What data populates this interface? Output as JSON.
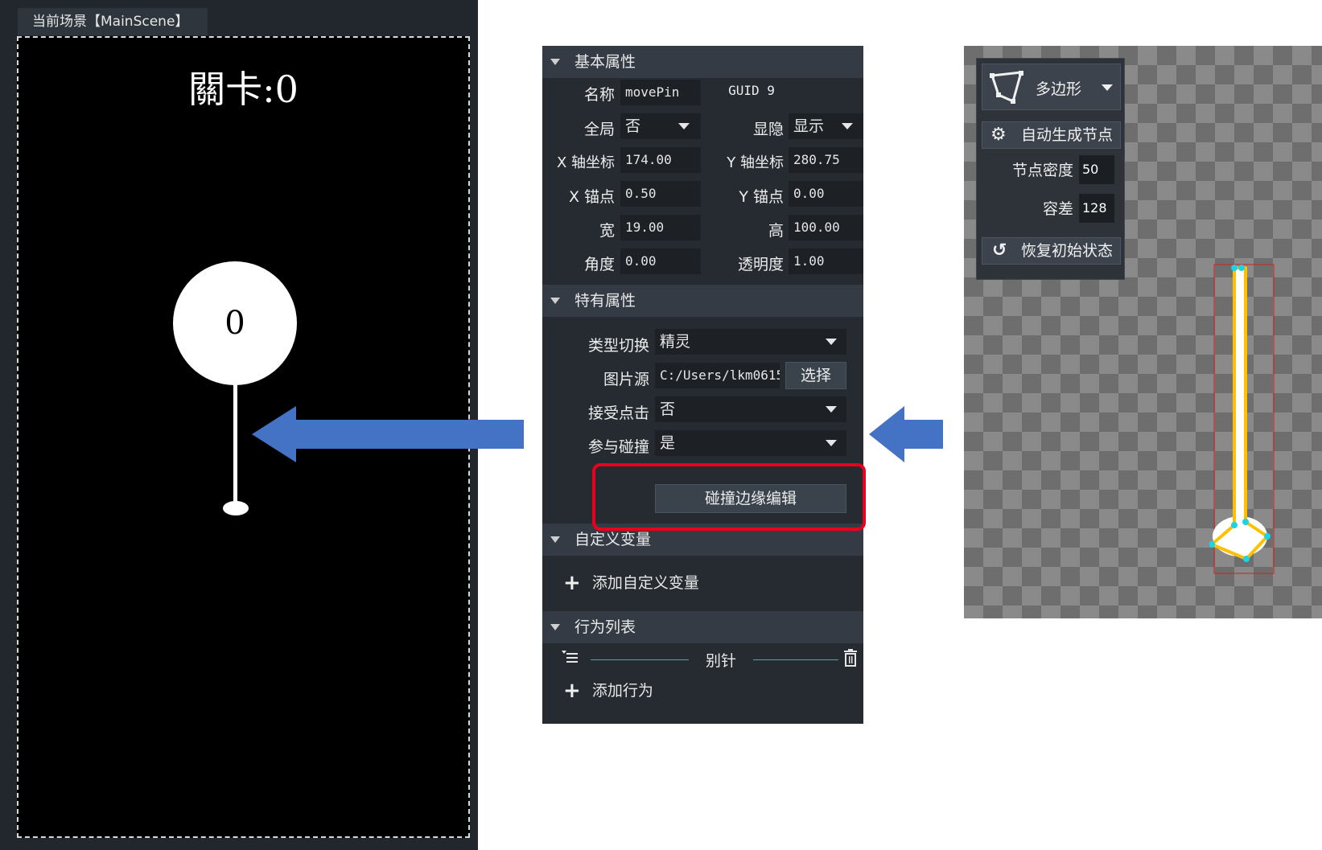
{
  "scene": {
    "tab_label": "当前场景【MainScene】",
    "level_text": "關卡:0",
    "ball_number": "0"
  },
  "props": {
    "basic_header": "基本属性",
    "name_label": "名称",
    "name_value": "movePin",
    "guid_text": "GUID 9",
    "global_label": "全局",
    "global_value": "否",
    "visibility_label": "显隐",
    "visibility_value": "显示",
    "x_label": "X 轴坐标",
    "x_value": "174.00",
    "y_label": "Y 轴坐标",
    "y_value": "280.75",
    "anchor_x_label": "X 锚点",
    "anchor_x_value": "0.50",
    "anchor_y_label": "Y 锚点",
    "anchor_y_value": "0.00",
    "width_label": "宽",
    "width_value": "19.00",
    "height_label": "高",
    "height_value": "100.00",
    "angle_label": "角度",
    "angle_value": "0.00",
    "opacity_label": "透明度",
    "opacity_value": "1.00",
    "special_header": "特有属性",
    "type_label": "类型切换",
    "type_value": "精灵",
    "image_label": "图片源",
    "image_value": "C:/Users/lkm0615",
    "select_button": "选择",
    "click_label": "接受点击",
    "click_value": "否",
    "collision_label": "参与碰撞",
    "collision_value": "是",
    "edge_edit_button": "碰撞边缘编辑",
    "custom_header": "自定义变量",
    "add_custom_var": "添加自定义变量",
    "behavior_header": "行为列表",
    "behavior_item": "别针",
    "add_behavior": "添加行为"
  },
  "editor": {
    "shape_mode": "多边形",
    "auto_nodes": "自动生成节点",
    "density_label": "节点密度",
    "density_value": "50",
    "tolerance_label": "容差",
    "tolerance_value": "128",
    "reset_label": "恢复初始状态"
  },
  "colors": {
    "arrow_blue": "#4472c4",
    "highlight_red": "#e8001c",
    "polygon_yellow": "#ffc000",
    "node_cyan": "#19d3e6"
  }
}
